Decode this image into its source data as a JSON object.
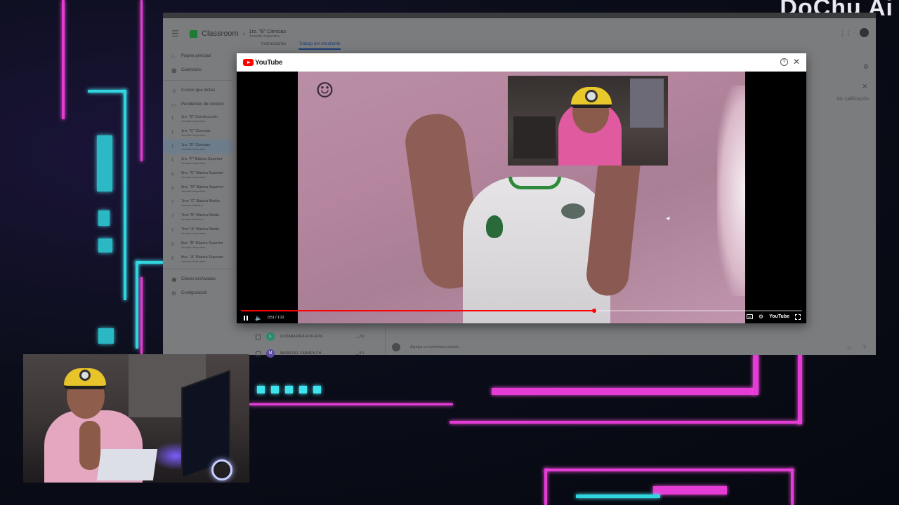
{
  "overlay": {
    "logo_text": "DoChu Ai"
  },
  "classroom": {
    "brand": "Classroom",
    "class_title": "1ro. \"B\" Ciencias",
    "class_subtitle": "Jornada Vespertina",
    "tabs": [
      {
        "label": "Instrucciones"
      },
      {
        "label": "Trabajo del estudiante",
        "active": true
      }
    ],
    "sidebar": {
      "home": "Página principal",
      "calendar": "Calendario",
      "teaching": "Cursos que dictas",
      "to_review": "Pendientes de revisión",
      "courses": [
        {
          "num": "1",
          "name": "1ro. \"B\" Construcción",
          "sub": "Jornada Vespertina"
        },
        {
          "num": "1",
          "name": "1ro. \"C\" Ciencias",
          "sub": "Jornada Vespertina"
        },
        {
          "num": "1",
          "name": "1ro. \"B\" Ciencias",
          "sub": "Jornada Vespertina",
          "selected": true
        },
        {
          "num": "1",
          "name": "1ro. \"F\" Básica Superior",
          "sub": "Jornada Vespertina"
        },
        {
          "num": "9",
          "name": "9no. \"E\" Básica Superior",
          "sub": "Jornada Vespertina"
        },
        {
          "num": "9",
          "name": "9no. \"D\" Básica Superior",
          "sub": "Jornada Vespertina"
        },
        {
          "num": "7",
          "name": "7mo \"C\" Básica Media",
          "sub": "Jornada Matutina"
        },
        {
          "num": "7",
          "name": "7mo \"B\" Básica Media",
          "sub": "Jornada Matutina"
        },
        {
          "num": "7",
          "name": "7mo \"A\" Básica Media",
          "sub": "Jornada Vespertina"
        },
        {
          "num": "8",
          "name": "8vo. \"B\" Básica Superior",
          "sub": "Jornada Vespertina"
        },
        {
          "num": "8",
          "name": "8vo. \"A\" Básica Superior",
          "sub": "Jornada Vespertina"
        }
      ],
      "archived": "Clases archivadas",
      "settings": "Configuración"
    },
    "grade_label": "Sin calificación",
    "students": [
      {
        "initial": "L",
        "name": "LUCIANA PAOLA VILLA M...",
        "score": "__/10"
      },
      {
        "initial": "M",
        "name": "MARÍA DEL CARMEN CH...",
        "score": "__/10"
      }
    ],
    "comment_placeholder": "Agregar un comentario privado..."
  },
  "youtube": {
    "brand": "YouTube",
    "help_glyph": "?",
    "close_glyph": "✕",
    "time": "0:51 / 1:22",
    "progress": 0.63,
    "cc_glyph": "cc",
    "settings_glyph": "⚙"
  },
  "colors": {
    "youtube_red": "#ff0000",
    "neon_pink": "#e63cd6",
    "neon_cyan": "#2fd6e0"
  }
}
